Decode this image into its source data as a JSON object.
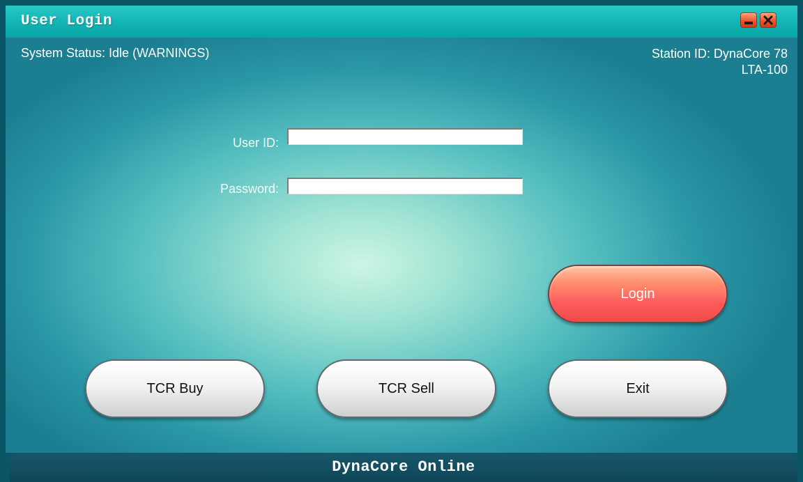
{
  "window": {
    "title": "User Login"
  },
  "status": {
    "system_status": "System Status: Idle (WARNINGS)",
    "station_id_line1": "Station ID: DynaCore 78",
    "station_id_line2": "LTA-100"
  },
  "form": {
    "user_id_label": "User ID:",
    "user_id_value": "",
    "password_label": "Password:",
    "password_value": ""
  },
  "buttons": {
    "login": "Login",
    "tcr_buy": "TCR Buy",
    "tcr_sell": "TCR Sell",
    "exit": "Exit"
  },
  "footer": {
    "text": "DynaCore Online"
  },
  "icons": {
    "minimize": "minimize-icon",
    "close": "close-icon"
  },
  "colors": {
    "titlebar": "#12b3b3",
    "login_button": "#ff5d5d",
    "footer": "#0f4658"
  }
}
